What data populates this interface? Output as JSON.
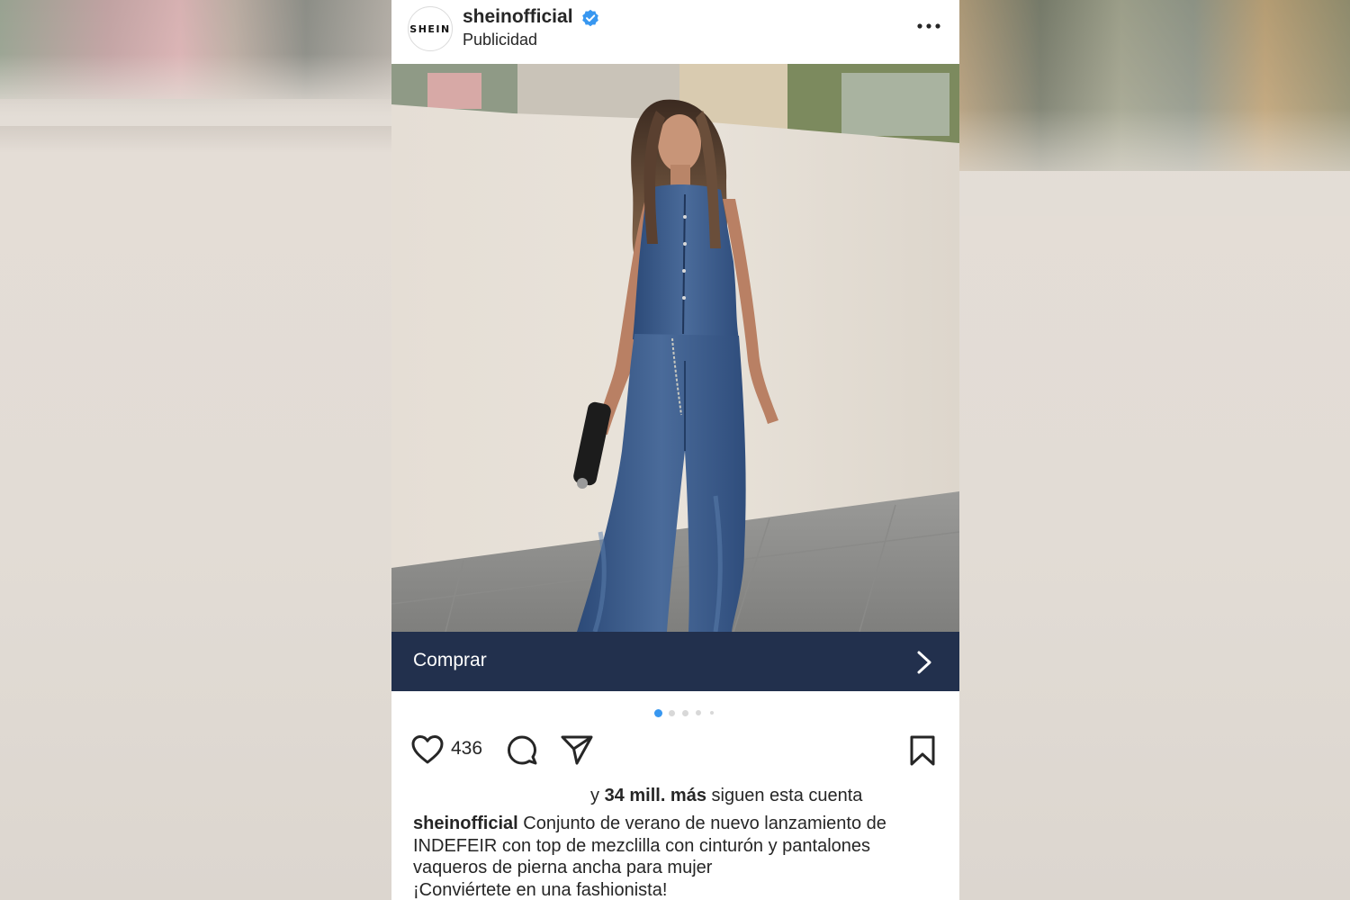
{
  "post": {
    "username": "sheinofficial",
    "avatar_text": "SHEIN",
    "subtitle": "Publicidad",
    "verified": true,
    "verified_color": "#3897f0",
    "cta_label": "Comprar",
    "cta_color": "#22304d",
    "likes": "436",
    "carousel": {
      "total": 5,
      "active_index": 0,
      "active_color": "#3897f0"
    },
    "followers": {
      "prefix": "y",
      "count": "34 mill. más",
      "suffix": "siguen esta cuenta"
    },
    "caption": {
      "user": "sheinofficial",
      "text": "Conjunto de verano de nuevo lanzamiento de INDEFEIR con top de mezclilla con cinturón y pantalones vaqueros de pierna ancha para mujer",
      "line2": "¡Conviértete en una fashionista!"
    }
  },
  "icons": {
    "verified": "verified-badge-icon",
    "more": "more-options-icon",
    "cta": "chevron-right-icon",
    "like": "heart-icon",
    "comment": "comment-icon",
    "share": "paper-plane-icon",
    "save": "bookmark-icon"
  }
}
